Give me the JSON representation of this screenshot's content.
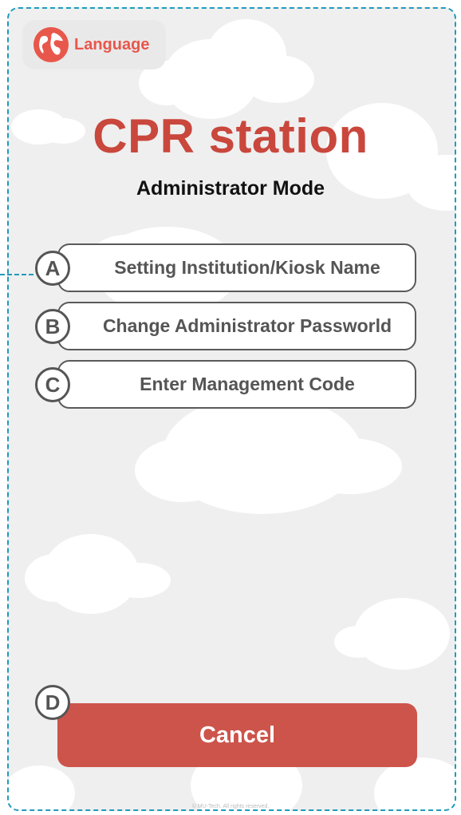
{
  "language_button": {
    "label": "Language",
    "icon": "globe-icon"
  },
  "title": "CPR station",
  "subtitle": "Administrator Mode",
  "menu": [
    {
      "marker": "A",
      "label": "Setting Institution/Kiosk Name"
    },
    {
      "marker": "B",
      "label": "Change Administrator Passworld"
    },
    {
      "marker": "C",
      "label": "Enter Management Code"
    }
  ],
  "cancel": {
    "marker": "D",
    "label": "Cancel"
  },
  "footer": "© MU-Tech. All rights reserved.",
  "colors": {
    "accent": "#c9473c",
    "cancel_bg": "#cd544b",
    "annotation_dash": "#1f9bbd",
    "background": "#efefef"
  }
}
